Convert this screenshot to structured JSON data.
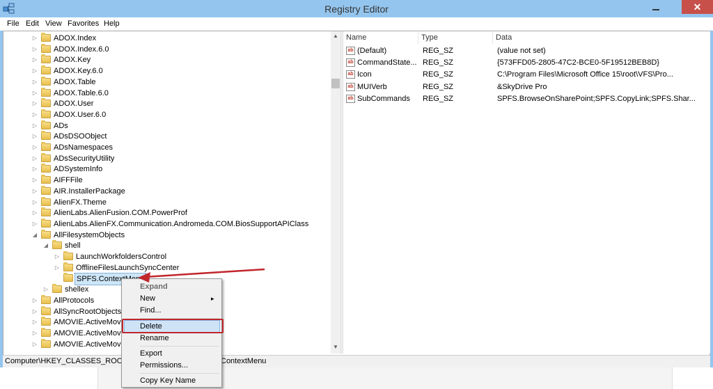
{
  "window": {
    "title": "Registry Editor",
    "close": "✕"
  },
  "menubar": [
    "File",
    "Edit",
    "View",
    "Favorites",
    "Help"
  ],
  "tree": {
    "nodes": [
      {
        "label": "ADOX.Index",
        "level": 0,
        "expander": "▷"
      },
      {
        "label": "ADOX.Index.6.0",
        "level": 0,
        "expander": "▷"
      },
      {
        "label": "ADOX.Key",
        "level": 0,
        "expander": "▷"
      },
      {
        "label": "ADOX.Key.6.0",
        "level": 0,
        "expander": "▷"
      },
      {
        "label": "ADOX.Table",
        "level": 0,
        "expander": "▷"
      },
      {
        "label": "ADOX.Table.6.0",
        "level": 0,
        "expander": "▷"
      },
      {
        "label": "ADOX.User",
        "level": 0,
        "expander": "▷"
      },
      {
        "label": "ADOX.User.6.0",
        "level": 0,
        "expander": "▷"
      },
      {
        "label": "ADs",
        "level": 0,
        "expander": "▷"
      },
      {
        "label": "ADsDSOObject",
        "level": 0,
        "expander": "▷"
      },
      {
        "label": "ADsNamespaces",
        "level": 0,
        "expander": "▷"
      },
      {
        "label": "ADsSecurityUtility",
        "level": 0,
        "expander": "▷"
      },
      {
        "label": "ADSystemInfo",
        "level": 0,
        "expander": "▷"
      },
      {
        "label": "AIFFFile",
        "level": 0,
        "expander": "▷"
      },
      {
        "label": "AIR.InstallerPackage",
        "level": 0,
        "expander": "▷"
      },
      {
        "label": "AlienFX.Theme",
        "level": 0,
        "expander": "▷"
      },
      {
        "label": "AlienLabs.AlienFusion.COM.PowerProf",
        "level": 0,
        "expander": "▷"
      },
      {
        "label": "AlienLabs.AlienFX.Communication.Andromeda.COM.BiosSupportAPIClass",
        "level": 0,
        "expander": "▷"
      },
      {
        "label": "AllFilesystemObjects",
        "level": 0,
        "expander": "◢"
      },
      {
        "label": "shell",
        "level": 1,
        "expander": "◢"
      },
      {
        "label": "LaunchWorkfoldersControl",
        "level": 2,
        "expander": "▷"
      },
      {
        "label": "OfflineFilesLaunchSyncCenter",
        "level": 2,
        "expander": "▷"
      },
      {
        "label": "SPFS.ContextMenu",
        "level": 2,
        "expander": "",
        "selected": true
      },
      {
        "label": "shellex",
        "level": 1,
        "expander": "▷"
      },
      {
        "label": "AllProtocols",
        "level": 0,
        "expander": "▷"
      },
      {
        "label": "AllSyncRootObjects",
        "level": 0,
        "expander": "▷"
      },
      {
        "label": "AMOVIE.ActiveMovie",
        "level": 0,
        "expander": "▷"
      },
      {
        "label": "AMOVIE.ActiveMovie",
        "level": 0,
        "expander": "▷"
      },
      {
        "label": "AMOVIE.ActiveMovie",
        "level": 0,
        "expander": "▷"
      }
    ]
  },
  "list": {
    "headers": [
      "Name",
      "Type",
      "Data"
    ],
    "rows": [
      {
        "name": "(Default)",
        "type": "REG_SZ",
        "data": "(value not set)"
      },
      {
        "name": "CommandState...",
        "type": "REG_SZ",
        "data": "{573FFD05-2805-47C2-BCE0-5F19512BEB8D}"
      },
      {
        "name": "Icon",
        "type": "REG_SZ",
        "data": "C:\\Program Files\\Microsoft Office 15\\root\\VFS\\Pro..."
      },
      {
        "name": "MUIVerb",
        "type": "REG_SZ",
        "data": "&SkyDrive Pro"
      },
      {
        "name": "SubCommands",
        "type": "REG_SZ",
        "data": "SPFS.BrowseOnSharePoint;SPFS.CopyLink;SPFS.Shar..."
      }
    ],
    "icon_text": "ab"
  },
  "statusbar": {
    "left": "Computer\\HKEY_CLASSES_ROOT\\Al",
    "right": "ContextMenu"
  },
  "context_menu": {
    "expand": "Expand",
    "new": "New",
    "submenu_arrow": "▸",
    "find": "Find...",
    "delete": "Delete",
    "rename": "Rename",
    "export": "Export",
    "permissions": "Permissions...",
    "copy_key_name": "Copy Key Name"
  },
  "colors": {
    "titlebar": "#94c5ee",
    "close": "#c7504a",
    "annotation": "#c0262c"
  }
}
